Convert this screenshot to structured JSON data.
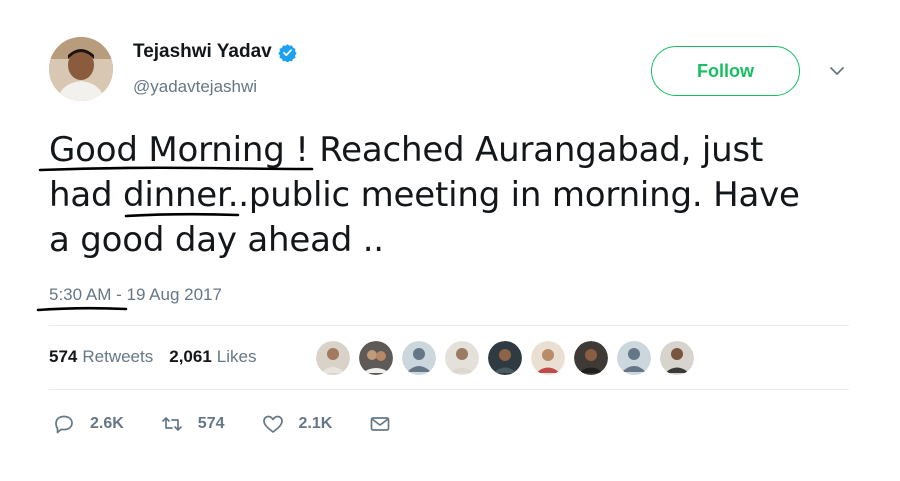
{
  "user": {
    "display_name": "Tejashwi Yadav",
    "handle": "@yadavtejashwi",
    "verified": true
  },
  "follow_button": {
    "label": "Follow"
  },
  "tweet": {
    "line1_part1": "Good Morning",
    "line1_part2": " ! Reached Aurangabad, just",
    "line2_part1": "had ",
    "line2_part2": "dinner",
    "line2_part3": "..public meeting in morning. Have",
    "line3": "a good day ahead .."
  },
  "timestamp": {
    "time": "5:30 AM",
    "separator": " - ",
    "date": "19 Aug 2017"
  },
  "stats": {
    "retweets_count": "574",
    "retweets_label": "Retweets",
    "likes_count": "2,061",
    "likes_label": "Likes"
  },
  "actions": {
    "replies": "2.6K",
    "retweets": "574",
    "likes": "2.1K"
  },
  "colors": {
    "follow_green": "#17bf63",
    "verified_blue": "#1da1f2",
    "muted_text": "#657786"
  },
  "icons": [
    "verified-badge-icon",
    "chevron-down-icon",
    "reply-icon",
    "retweet-icon",
    "like-icon",
    "message-icon"
  ]
}
